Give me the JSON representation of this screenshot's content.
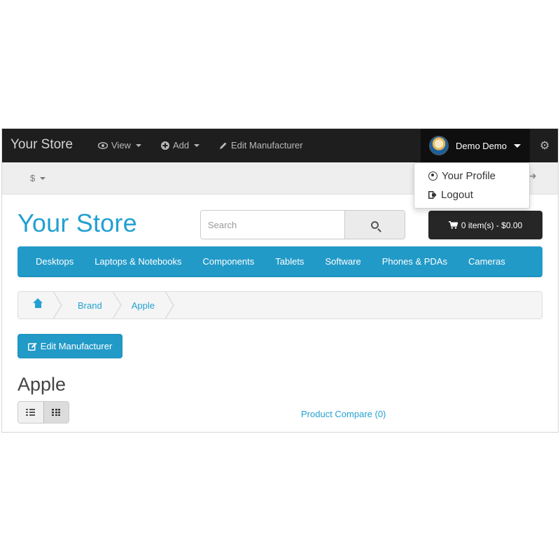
{
  "admin_bar": {
    "brand": "Your Store",
    "menus": [
      {
        "label": "View",
        "icon": "eye-icon"
      },
      {
        "label": "Add",
        "icon": "plus-circle-icon"
      },
      {
        "label": "Edit Manufacturer",
        "icon": "pencil-icon"
      }
    ],
    "user_name": "Demo Demo",
    "dropdown": [
      {
        "label": "Your Profile",
        "icon": "user-circle-icon"
      },
      {
        "label": "Logout",
        "icon": "sign-out-icon"
      }
    ]
  },
  "top_strip": {
    "currency": "$"
  },
  "header": {
    "logo": "Your Store",
    "search_placeholder": "Search",
    "cart_label": "0 item(s) - $0.00"
  },
  "categories": [
    "Desktops",
    "Laptops & Notebooks",
    "Components",
    "Tablets",
    "Software",
    "Phones & PDAs",
    "Cameras"
  ],
  "breadcrumb": [
    "Brand",
    "Apple"
  ],
  "content": {
    "edit_button": "Edit Manufacturer",
    "heading": "Apple",
    "product_compare": "Product Compare (0)"
  },
  "colors": {
    "accent": "#229ac8",
    "link": "#23a1d1",
    "admin_bar": "#1e1e1e",
    "cart_button": "#262626"
  }
}
